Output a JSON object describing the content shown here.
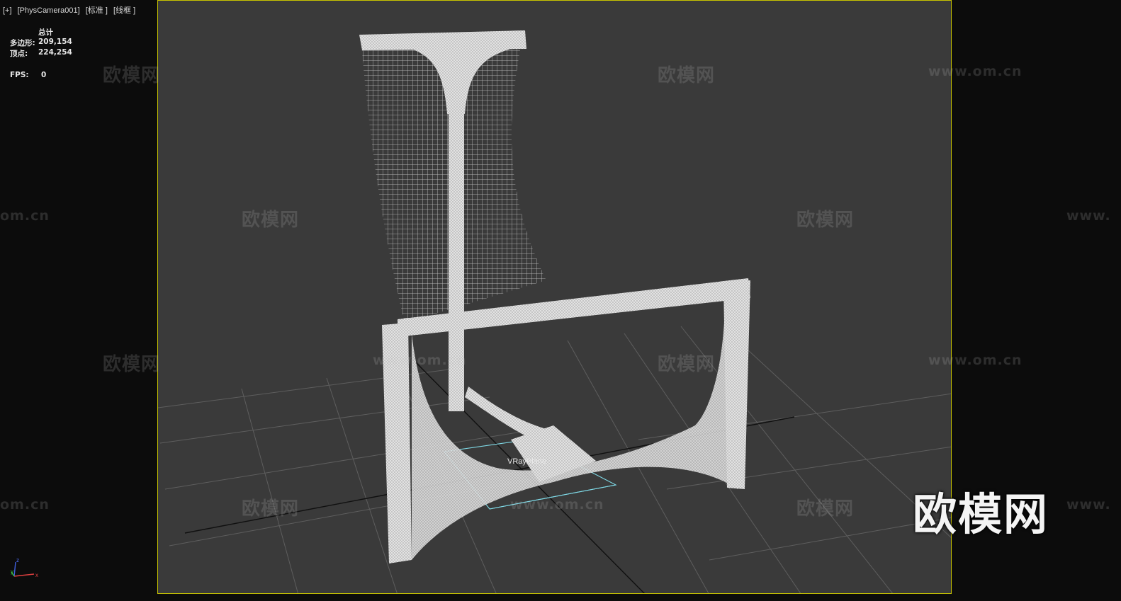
{
  "viewport": {
    "menu_label": "[+]",
    "camera_label": "[PhysCamera001]",
    "shading_label": "[标准 ]",
    "display_label": "[线框 ]"
  },
  "stats": {
    "total_label": "总计",
    "polygons_label": "多边形:",
    "polygons_value": "209,154",
    "vertices_label": "顶点:",
    "vertices_value": "224,254",
    "fps_label": "FPS:",
    "fps_value": "0"
  },
  "scene": {
    "object_label": "VRayPlane",
    "frame_color": "#c8c400",
    "background_color": "#3a3a3a",
    "wire_color": "#d6d6d6",
    "gizmo_color": "#7fd9e6"
  },
  "watermarks": {
    "brand": "欧模网",
    "url": "www.om.cn",
    "url_partial_left": "om.cn",
    "url_partial_right": "www.",
    "url_fragment": "www.om.cn"
  },
  "axis_gizmo": {
    "x": "x",
    "y": "y",
    "z": "z"
  }
}
